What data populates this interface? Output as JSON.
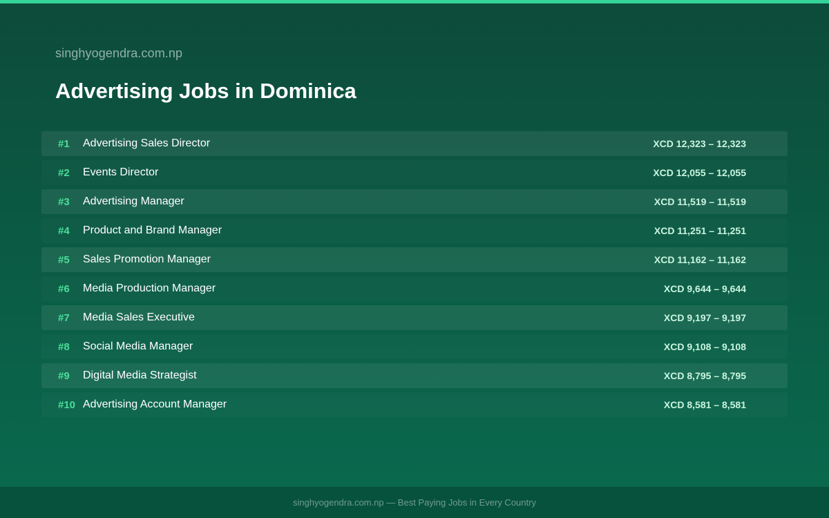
{
  "site_name": "singhyogendra.com.np",
  "title": "Advertising Jobs in Dominica",
  "jobs": [
    {
      "rank": "#1",
      "title": "Advertising Sales Director",
      "salary": "XCD 12,323 – 12,323"
    },
    {
      "rank": "#2",
      "title": "Events Director",
      "salary": "XCD 12,055 – 12,055"
    },
    {
      "rank": "#3",
      "title": "Advertising Manager",
      "salary": "XCD 11,519 – 11,519"
    },
    {
      "rank": "#4",
      "title": "Product and Brand Manager",
      "salary": "XCD 11,251 – 11,251"
    },
    {
      "rank": "#5",
      "title": "Sales Promotion Manager",
      "salary": "XCD 11,162 – 11,162"
    },
    {
      "rank": "#6",
      "title": "Media Production Manager",
      "salary": "XCD 9,644 – 9,644"
    },
    {
      "rank": "#7",
      "title": "Media Sales Executive",
      "salary": "XCD 9,197 – 9,197"
    },
    {
      "rank": "#8",
      "title": "Social Media Manager",
      "salary": "XCD 9,108 – 9,108"
    },
    {
      "rank": "#9",
      "title": "Digital Media Strategist",
      "salary": "XCD 8,795 – 8,795"
    },
    {
      "rank": "#10",
      "title": "Advertising Account Manager",
      "salary": "XCD 8,581 – 8,581"
    }
  ],
  "footer": "singhyogendra.com.np — Best Paying Jobs in Every Country",
  "colors": {
    "accent": "#34d399",
    "rank": "#4ade9a",
    "background_top": "#0d4b3a",
    "background_bottom": "#0a6a4e"
  }
}
